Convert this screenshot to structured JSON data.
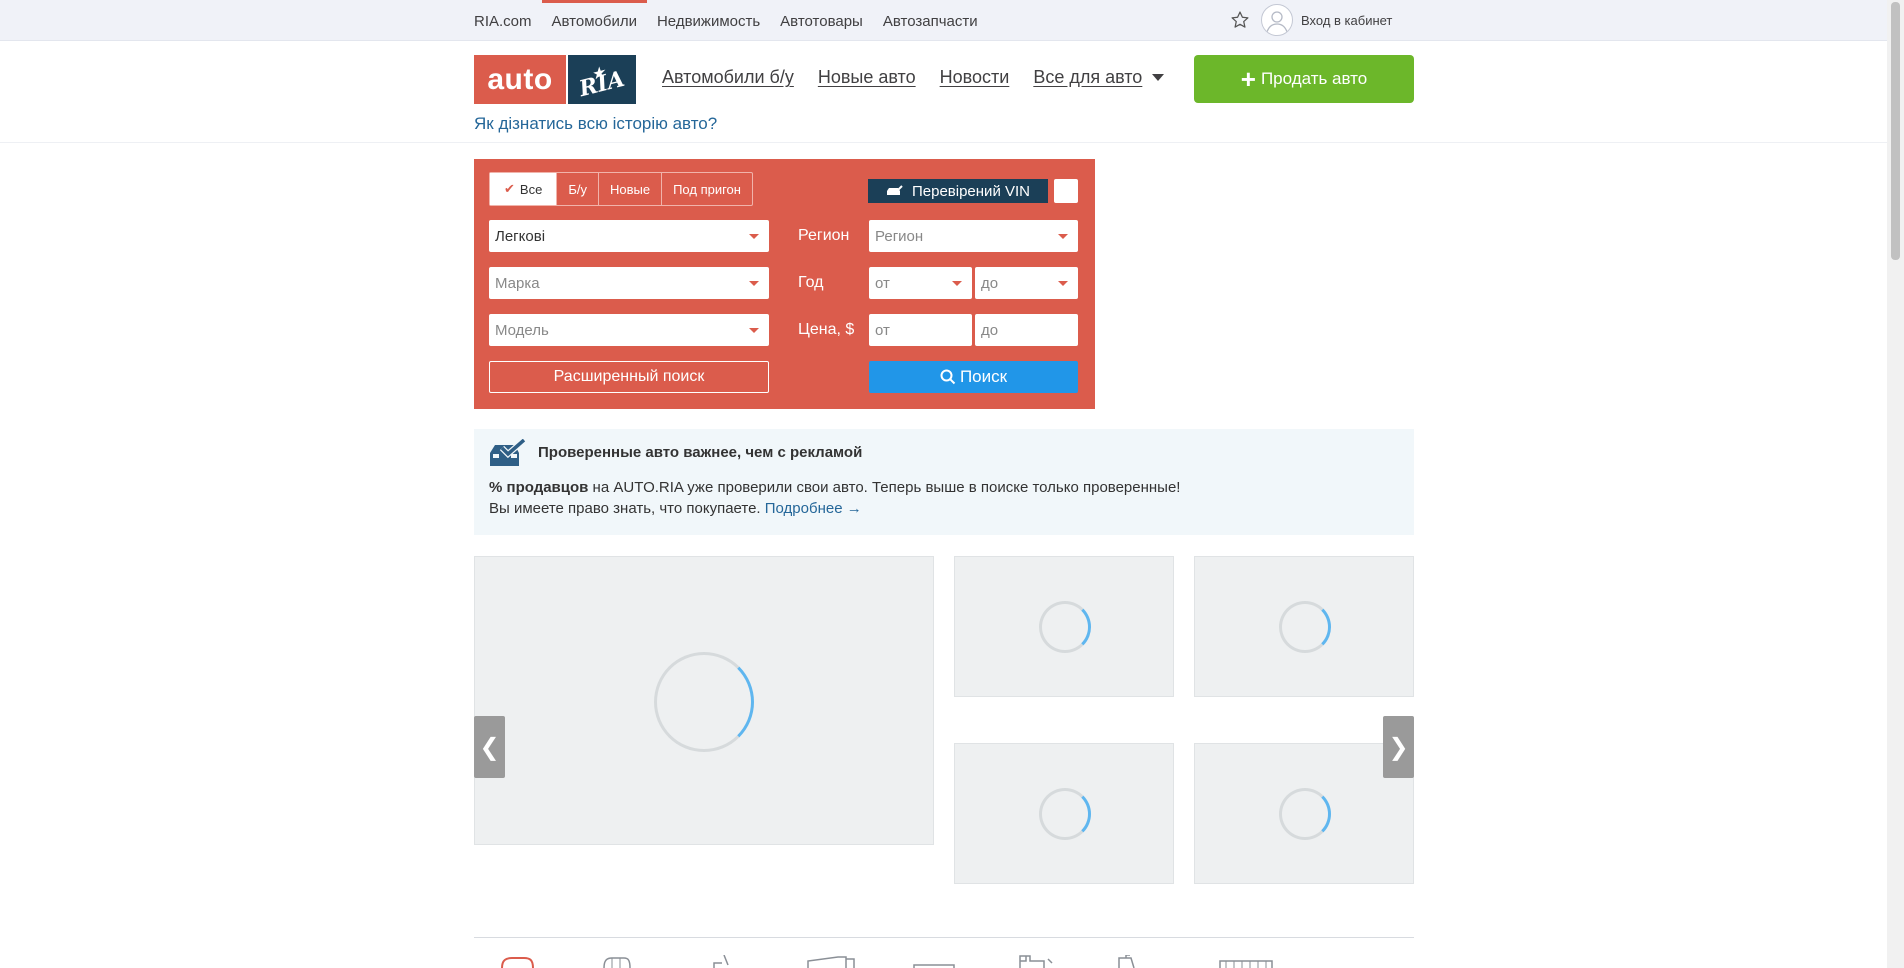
{
  "topbar": {
    "links": [
      "RIA.com",
      "Автомобили",
      "Недвижимость",
      "Автотовары",
      "Автозапчасти"
    ],
    "active": "Автомобили",
    "login_label": "Вход в кабинет"
  },
  "header": {
    "logo_auto": "auto",
    "logo_ria": "RIA",
    "nav": [
      "Автомобили б/у",
      "Новые авто",
      "Новости",
      "Все для авто"
    ],
    "sell_label": "Продать авто",
    "history_link": "Як дізнатись всю історію авто?"
  },
  "search": {
    "tabs": [
      "Все",
      "Б/у",
      "Новые",
      "Под пригон"
    ],
    "vin_label": "Перевірений VIN",
    "type_value": "Легкові",
    "brand_placeholder": "Марка",
    "model_placeholder": "Модель",
    "region_label": "Регион",
    "region_placeholder": "Регион",
    "year_label": "Год",
    "year_from": "от",
    "year_to": "до",
    "price_label": "Цена, $",
    "price_from": "от",
    "price_to": "до",
    "advanced_label": "Расширенный поиск",
    "search_label": "Поиск"
  },
  "info": {
    "title": "Проверенные авто важнее, чем с рекламой",
    "line1_bold": "% продавцов",
    "line1_rest": " на AUTO.RIA уже проверили свои авто. Теперь выше в поиске только проверенные!",
    "line2": "Вы имеете право знать, что покупаете. ",
    "more_link": "Подробнее →"
  },
  "carousel": {
    "prev": "❮",
    "next": "❯"
  },
  "colors": {
    "brand_red": "#db5c4c",
    "brand_navy": "#1b3f57",
    "sell_green": "#6cb72a",
    "search_blue": "#2196e8",
    "link_blue": "#256799"
  }
}
